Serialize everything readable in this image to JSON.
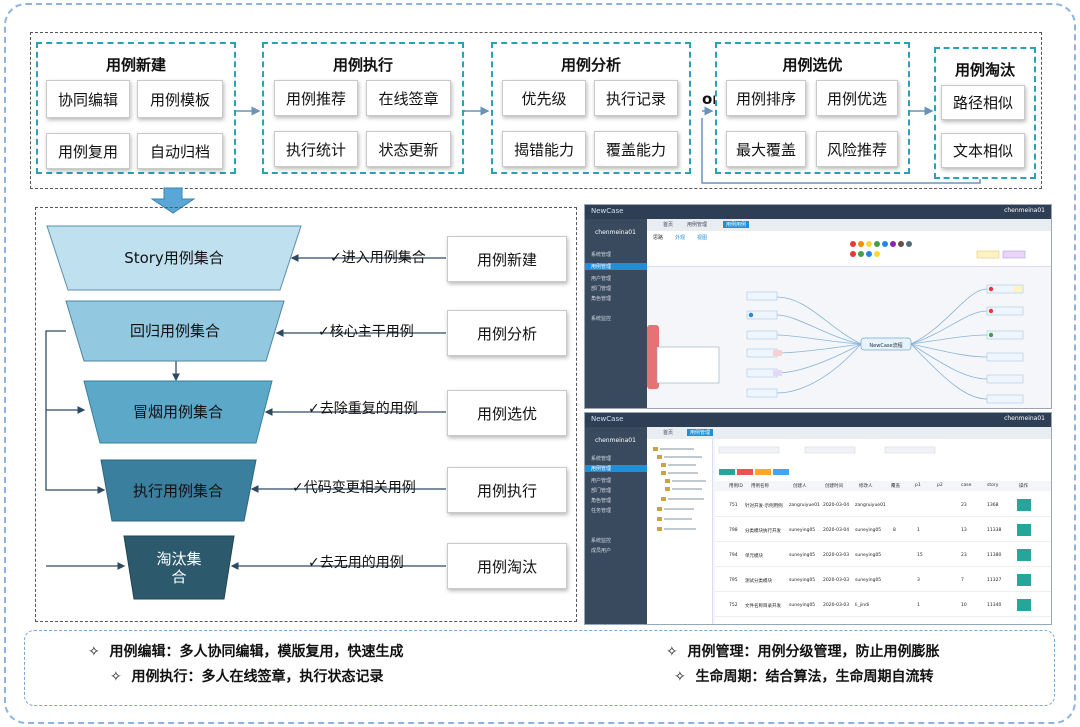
{
  "colors": {
    "phase_border": "#2aa1b8",
    "funnel_story": "#bfe0ef",
    "funnel_regression": "#93c9e0",
    "funnel_smoke": "#5ba8c8",
    "funnel_exec": "#3a7f9e",
    "funnel_eliminate": "#2c5a6c",
    "connector": "#2e4a63"
  },
  "phases": [
    {
      "title": "用例新建",
      "buttons": [
        "协同编辑",
        "用例模板",
        "用例复用",
        "自动归档"
      ]
    },
    {
      "title": "用例执行",
      "buttons": [
        "用例推荐",
        "在线签章",
        "执行统计",
        "状态更新"
      ]
    },
    {
      "title": "用例分析",
      "buttons": [
        "优先级",
        "执行记录",
        "揭错能力",
        "覆盖能力"
      ]
    },
    {
      "title": "用例选优",
      "buttons": [
        "用例排序",
        "用例优选",
        "最大覆盖",
        "风险推荐"
      ]
    },
    {
      "title": "用例淘汰",
      "buttons": [
        "路径相似",
        "文本相似"
      ]
    }
  ],
  "or_label": "or",
  "funnel": {
    "levels": [
      "Story用例集合",
      "回归用例集合",
      "冒烟用例集合",
      "执行用例集合",
      "淘汰集\n合"
    ],
    "arrow_labels": [
      "✓进入用例集合",
      "✓核心主干用例",
      "✓去除重复的用例",
      "✓代码变更相关用例",
      "✓去无用的用例"
    ],
    "right_boxes": [
      "用例新建",
      "用例分析",
      "用例选优",
      "用例执行",
      "用例淘汰"
    ]
  },
  "screenshot_top": {
    "brand": "NewCase",
    "user": "chenmeina01",
    "user_short": "chenmeina01",
    "sidebar": [
      "系统管理",
      "用例管理",
      "用户管理",
      "部门管理",
      "角色管理",
      "系统监控"
    ],
    "tabs": [
      "首页",
      "用例管理",
      "用例用例"
    ],
    "toolbar_tabs": [
      "思路",
      "外观",
      "视图"
    ],
    "center_node": "NewCase流程"
  },
  "screenshot_bottom": {
    "brand": "NewCase",
    "user": "chenmeina01",
    "sidebar": [
      "系统管理",
      "用例管理",
      "用户管理",
      "部门管理",
      "角色管理",
      "任务管理",
      "系统监控",
      "成员用户"
    ],
    "tabs": [
      "首页",
      "用例管理"
    ],
    "columns": [
      "用例ID",
      "用例名称",
      "创建人",
      "创建时间",
      "修改人",
      "覆盖",
      "p1",
      "p2",
      "case",
      "story",
      "操作"
    ],
    "rows": [
      [
        "751",
        "针对开发-示例用例",
        "zangruiyue01",
        "2020-03-04",
        "zangruiyue01",
        "",
        "",
        "",
        "23",
        "1368"
      ],
      [
        "798",
        "分类模块执行开发",
        "suneying05",
        "2020-03-04",
        "suneying05",
        "8",
        "1",
        "",
        "13",
        "11338"
      ],
      [
        "794",
        "单元模块",
        "suneying05",
        "2020-03-03",
        "suneying05",
        "",
        "15",
        "",
        "23",
        "11380"
      ],
      [
        "795",
        "测试分类模块",
        "suneying05",
        "2020-03-03",
        "suneying05",
        "",
        "3",
        "",
        "7",
        "11327"
      ],
      [
        "752",
        "文件名称目录开发",
        "suneying05",
        "2020-03-03",
        "li_jindi",
        "",
        "1",
        "",
        "10",
        "11340"
      ]
    ]
  },
  "notes": [
    {
      "label": "用例编辑：",
      "text": "多人协同编辑，模版复用，快速生成"
    },
    {
      "label": "用例管理：",
      "text": "用例分级管理，防止用例膨胀"
    },
    {
      "label": "用例执行：",
      "text": "多人在线签章，执行状态记录"
    },
    {
      "label": "生命周期：",
      "text": "结合算法，生命周期自流转"
    }
  ],
  "note_bullet": "✧"
}
